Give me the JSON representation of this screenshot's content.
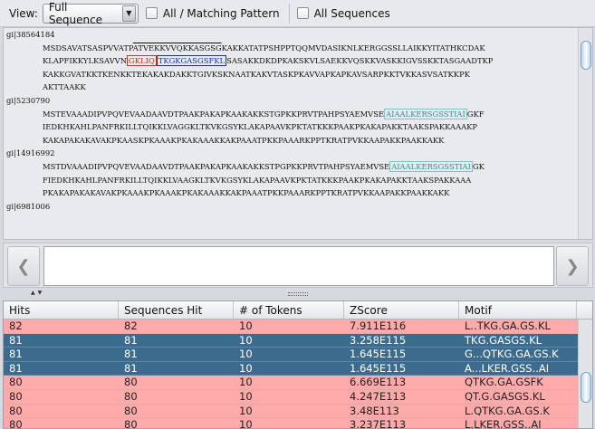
{
  "toolbar": {
    "view_label": "View:",
    "view_value": "Full Sequence",
    "check_matching": "All / Matching Pattern",
    "check_sequences": "All Sequences"
  },
  "sequences": [
    {
      "id": "gi|38564184",
      "lines": [
        [
          "MSDSAVATSASPVVATP",
          "ATVEKKVVQKKASGSG",
          "KAKKATATPSHPPTQQMVDASIKNLKERGGSSLLAIKKYITATHKCDAK"
        ],
        [
          "KLAPFIKKYLKSAVVN",
          "GKLIQ",
          "TKGKGASGSFKL",
          "SASAKKDKDPKAKSKVLSAEKKVQSKKVASKKIGVSSKKTASGAADTKP"
        ],
        [
          "KAKKGVATKKTKENKKTEKAKAKDAKKTGIVKSKNAATKAKVTASKPKAVVAPKAPKAVSARPKKTVKKASVSATKKPK"
        ],
        [
          "AKTTAAKK"
        ]
      ]
    },
    {
      "id": "gi|5230790",
      "lines": [
        [
          "MSTEVAAADIPVPQVEVAADAAVDTPAAKPAKAPKAAKAKKSTGPKKPRVTPAHPSYAEMVSE",
          "AIAALKERSGSSTIAI",
          "GKF"
        ],
        [
          "IEDKHKAHLPANFRKILLTQIKKLVAGGKLTKVKGSYKLAKAPAAVKPKTATKKKPAAKPKAKAPAKKTAAKSPAKKAAAKP"
        ],
        [
          "KAKAPAKAKAVAKPKAASKPKAAAKPKAKAAAKKAKPAAATPKKPAAARKPPTKRATPVKKAAPAKKPAAKKAKK"
        ]
      ]
    },
    {
      "id": "gi|14916992",
      "lines": [
        [
          "MSTDVAAADIPVPQVEVAADAAVDTPAAKPAKAPKAAKAKKSTPGPKKPRVTPAHPSYAEMVSE",
          "AIAALKERSGSSTIAI",
          "GK"
        ],
        [
          "FIEDKHKAHLPANFRKILLTQIKKLVAAGKLTKVKGSYKLAKAPAAVKPKTATKKKPAAKPKAKAPAKKTAAKSPAKKAAA"
        ],
        [
          "PKAKAPAKAKAVAKPKAAAKPKAAAKPKAKAAAKKAKPAAATPKKPAAARKPPTKRATPVKKAAPAKKPAAKKAKK"
        ]
      ]
    },
    {
      "id": "gi|6981006",
      "lines": []
    }
  ],
  "table": {
    "headers": [
      "Hits",
      "Sequences Hit",
      "# of Tokens",
      "ZScore",
      "Motif"
    ],
    "rows": [
      {
        "hits": "82",
        "seq": "82",
        "tokens": "10",
        "zscore": "7.911E116",
        "motif": "L..TKG.GA.GS.KL",
        "style": "pink"
      },
      {
        "hits": "81",
        "seq": "81",
        "tokens": "10",
        "zscore": "3.258E115",
        "motif": "TKG.GASGS.KL",
        "style": "sel"
      },
      {
        "hits": "81",
        "seq": "81",
        "tokens": "10",
        "zscore": "1.645E115",
        "motif": "G...QTKG.GA.GS.K",
        "style": "sel"
      },
      {
        "hits": "81",
        "seq": "81",
        "tokens": "10",
        "zscore": "1.645E115",
        "motif": "A...LKER.GSS..AI",
        "style": "sel"
      },
      {
        "hits": "80",
        "seq": "80",
        "tokens": "10",
        "zscore": "6.669E113",
        "motif": "QTKG.GA.GSFK",
        "style": "pink"
      },
      {
        "hits": "80",
        "seq": "80",
        "tokens": "10",
        "zscore": "4.247E113",
        "motif": "QT.G.GASGS.KL",
        "style": "pink"
      },
      {
        "hits": "80",
        "seq": "80",
        "tokens": "10",
        "zscore": "3.48E113",
        "motif": "L.QTKG.GA.GS.K",
        "style": "pink"
      },
      {
        "hits": "80",
        "seq": "80",
        "tokens": "10",
        "zscore": "3.237E113",
        "motif": "L.LKER.GSS..AI",
        "style": "pink"
      }
    ]
  }
}
